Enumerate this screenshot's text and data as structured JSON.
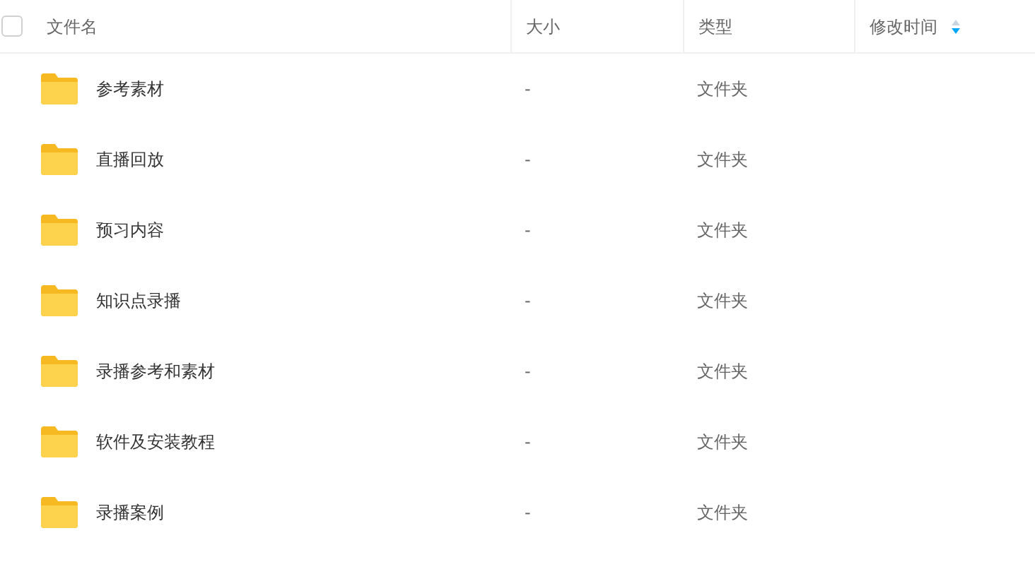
{
  "header": {
    "select_all": {
      "checked": false
    },
    "columns": [
      {
        "label": "文件名"
      },
      {
        "label": "大小"
      },
      {
        "label": "类型"
      },
      {
        "label": "修改时间",
        "sortable": true
      }
    ]
  },
  "rows": [
    {
      "name": "参考素材",
      "size": "-",
      "type": "文件夹"
    },
    {
      "name": "直播回放",
      "size": "-",
      "type": "文件夹"
    },
    {
      "name": "预习内容",
      "size": "-",
      "type": "文件夹"
    },
    {
      "name": "知识点录播",
      "size": "-",
      "type": "文件夹"
    },
    {
      "name": "录播参考和素材",
      "size": "-",
      "type": "文件夹"
    },
    {
      "name": "软件及安装教程",
      "size": "-",
      "type": "文件夹"
    },
    {
      "name": "录播案例",
      "size": "-",
      "type": "文件夹"
    }
  ]
}
